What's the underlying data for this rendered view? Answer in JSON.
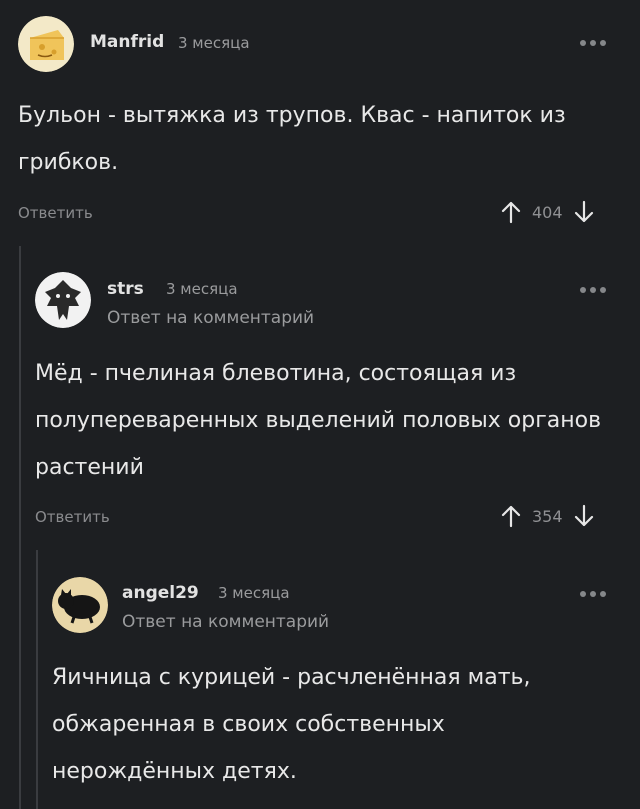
{
  "comments": [
    {
      "username": "Manfrid",
      "time": "3 месяца",
      "reply_to": "",
      "text": "Бульон - вытяжка из трупов. Квас - напиток из грибков.",
      "reply_label": "Ответить",
      "rating": "404",
      "avatar_icon": "cheese-face-avatar"
    },
    {
      "username": "strs",
      "time": "3 месяца",
      "reply_to": "Ответ на комментарий",
      "text": "Мёд - пчелиная блевотина, состоящая из полупереваренных выделений половых органов растений",
      "reply_label": "Ответить",
      "rating": "354",
      "avatar_icon": "wolf-medallion-avatar"
    },
    {
      "username": "angel29",
      "time": "3 месяца",
      "reply_to": "Ответ на комментарий",
      "text": "Яичница с курицей - расчленённая мать, обжаренная в своих собственных нерождённых детях.",
      "avatar_icon": "black-cat-avatar"
    }
  ],
  "colors": {
    "background": "#1d1f22",
    "text": "#e8e8e8",
    "muted": "#9a9b9d",
    "thread_line": "#3a3c40"
  }
}
